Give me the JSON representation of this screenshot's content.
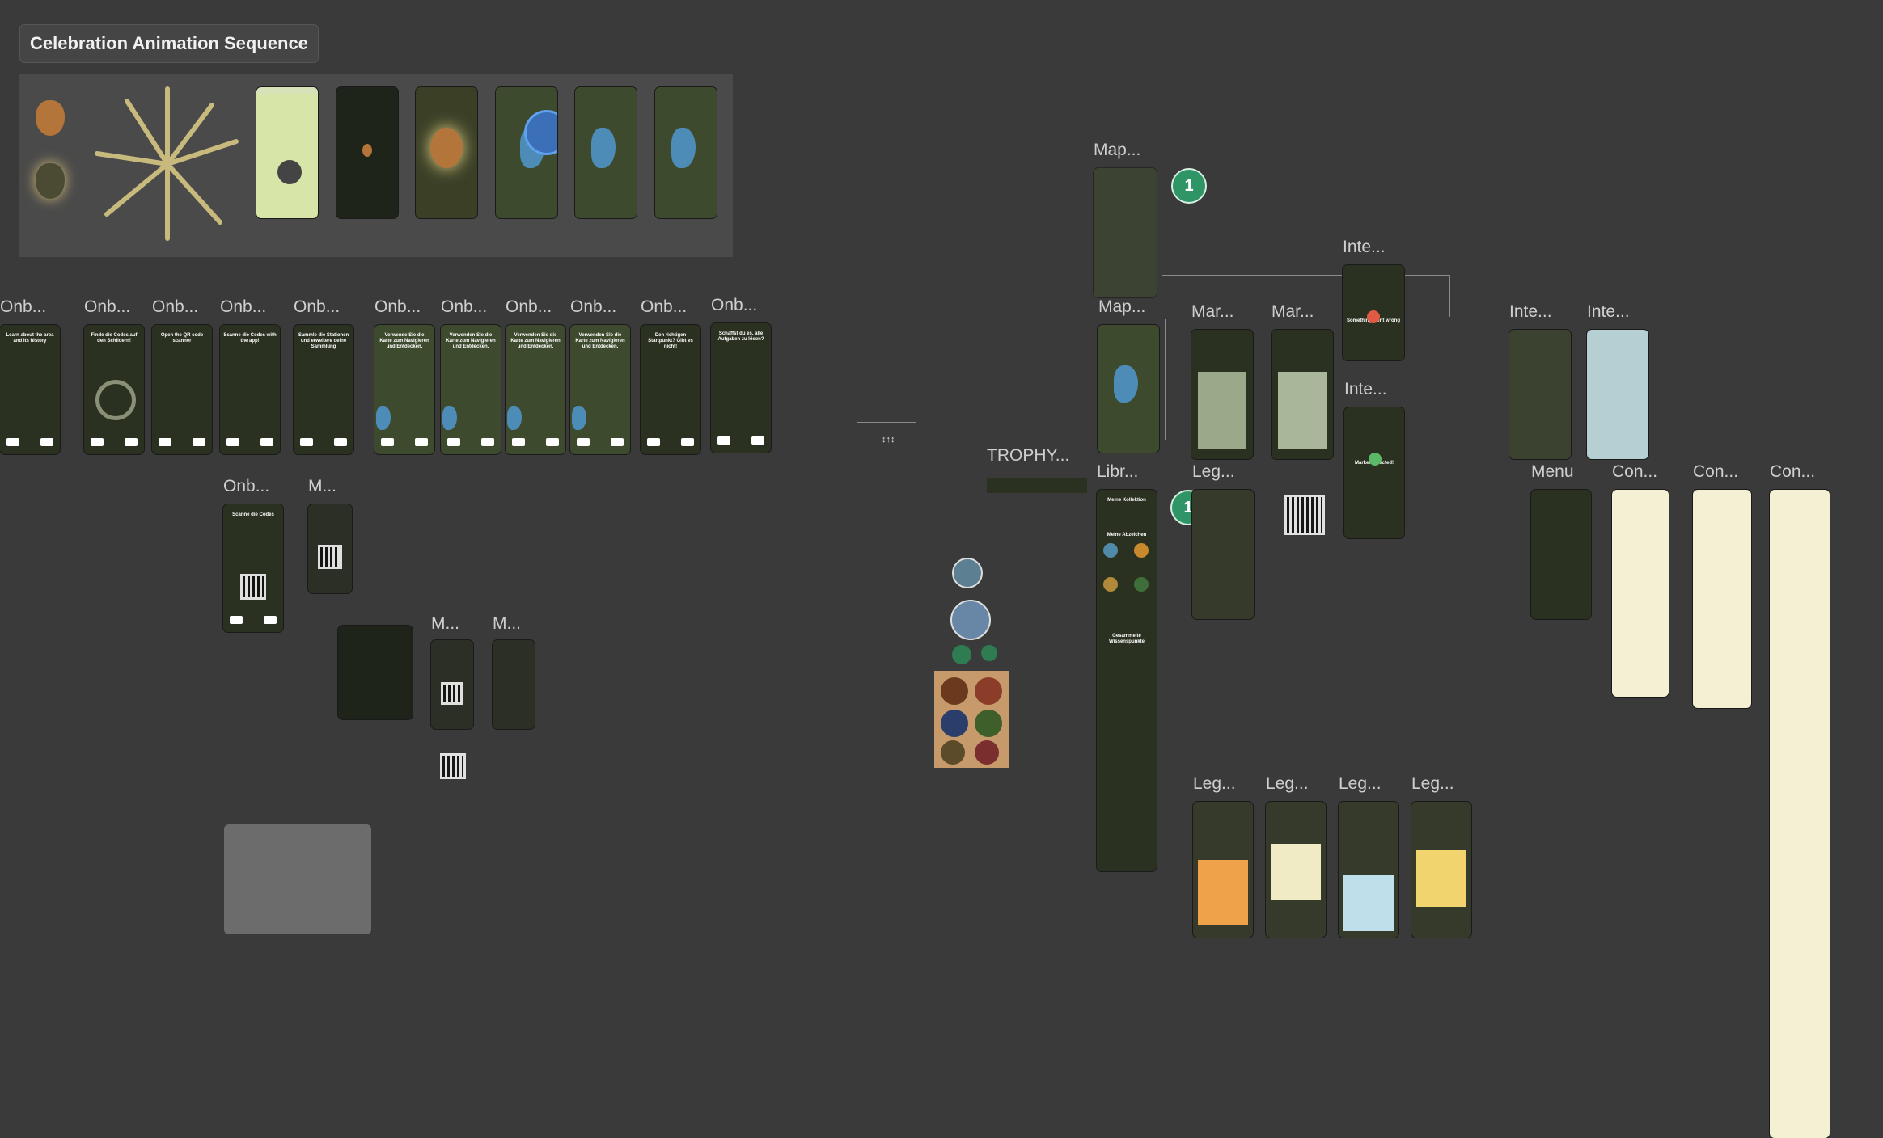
{
  "section": {
    "title": "Celebration Animation Sequence"
  },
  "labels": {
    "map1": "Map...",
    "map2": "Map...",
    "inte1": "Inte...",
    "inte2": "Inte...",
    "inte3": "Inte...",
    "inte4": "Inte...",
    "mar1": "Mar...",
    "mar2": "Mar...",
    "trophy": "TROPHY...",
    "libr": "Libr...",
    "leg1": "Leg...",
    "menu": "Menu",
    "con1": "Con...",
    "con2": "Con...",
    "con3": "Con...",
    "leg2": "Leg...",
    "leg3": "Leg...",
    "leg4": "Leg...",
    "leg5": "Leg...",
    "onb": [
      "Onb...",
      "Onb...",
      "Onb...",
      "Onb...",
      "Onb...",
      "Onb...",
      "Onb...",
      "Onb...",
      "Onb...",
      "Onb...",
      "Onb..."
    ],
    "onb_small": "Onb...",
    "m1": "M...",
    "m2": "M...",
    "m3": "M..."
  },
  "badges": [
    "1",
    "1"
  ],
  "onboarding": [
    "Learn about the area and its history",
    "Finde die Codes auf den Schildern!",
    "Open the QR code scanner",
    "Scanne die Codes with the app!",
    "Sammle die Stationen und erweitere deine Sammlung",
    "Verwende Sie die Karte zum Navigieren und Entdecken.",
    "Verwenden Sie die Karte zum Navigieren und Entdecken.",
    "Verwenden Sie die Karte zum Navigieren und Entdecken.",
    "Verwenden Sie die Karte zum Navigieren und Entdecken.",
    "Den richtigen Startpunkt? Gibt es nicht!",
    "Schaffst du es, alle Aufgaben zu lösen?"
  ],
  "scanner_title": "Scanne die Codes",
  "marker": {
    "error": "Something went wrong",
    "success": "Marker detected!"
  },
  "library": {
    "title": "Meine Kollektion",
    "subtitle": "Meine Abzeichen",
    "knowledge": "Gesammelte Wissenspunkte"
  },
  "misc_text": "↕↑↕",
  "colors": {
    "canvas": "#3a3a3a",
    "phone": "#2b3120",
    "badge": "#2f9466",
    "lake": "#4e8cb8"
  }
}
